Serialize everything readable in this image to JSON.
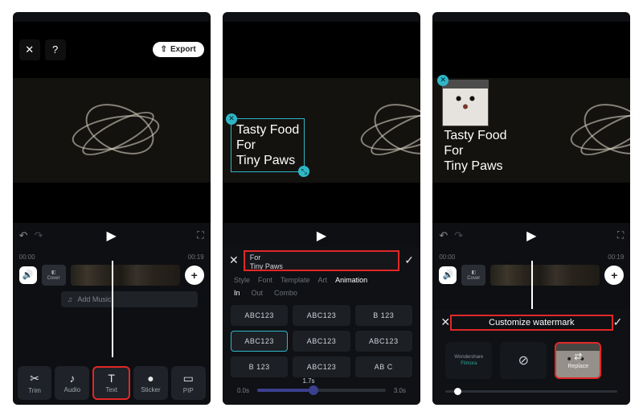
{
  "screen1": {
    "export_label": "Export",
    "timecodes": [
      "00:00",
      "00:19"
    ],
    "cover_label": "Cover",
    "add_music_label": "Add Music",
    "tools": [
      {
        "icon": "✂",
        "label": "Trim"
      },
      {
        "icon": "♪",
        "label": "Audio"
      },
      {
        "icon": "T",
        "label": "Text"
      },
      {
        "icon": "●",
        "label": "Sticker"
      },
      {
        "icon": "▭",
        "label": "PIP"
      }
    ],
    "highlight_tool_index": 2
  },
  "screen2": {
    "overlay_lines": [
      "Tasty Food",
      "For",
      "Tiny Paws"
    ],
    "input_lines": [
      "For",
      "Tiny Paws"
    ],
    "tabs": [
      "Style",
      "Font",
      "Template",
      "Art",
      "Animation"
    ],
    "active_tab_index": 4,
    "subtabs": [
      "In",
      "Out",
      "Combo"
    ],
    "active_subtab_index": 0,
    "anim_presets": [
      "ABC123",
      "ABC123",
      "B 123",
      "ABC123",
      "ABC123",
      "ABC123",
      "B 123",
      "ABC123",
      "AB  C"
    ],
    "selected_preset_index": 3,
    "highlight_preset_index": 3,
    "speed_min": "0.0s",
    "speed_val": "1.7s",
    "speed_max": "3.0s"
  },
  "screen3": {
    "overlay_lines": [
      "Tasty Food",
      "For",
      "Tiny Paws"
    ],
    "timecodes": [
      "00:00",
      "00:19"
    ],
    "cover_label": "Cover",
    "wm_title": "Customize watermark",
    "wm_filmora_line1": "Wondershare",
    "wm_filmora_line2": "Filmora",
    "wm_none_icon": "⊘",
    "wm_replace_label": "Replace"
  }
}
